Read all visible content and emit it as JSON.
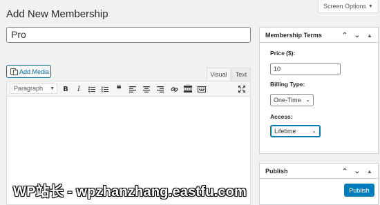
{
  "header": {
    "screen_options": "Screen Options",
    "page_title": "Add New Membership"
  },
  "title_field": {
    "value": "Pro"
  },
  "editor": {
    "add_media_label": "Add Media",
    "tabs": [
      "Visual",
      "Text"
    ],
    "active_tab": "Visual",
    "format_select": "Paragraph",
    "toolbar_icons": [
      "bold-icon",
      "italic-icon",
      "bulleted-list-icon",
      "numbered-list-icon",
      "blockquote-icon",
      "align-left-icon",
      "align-center-icon",
      "align-right-icon",
      "link-icon",
      "toolbar-toggle-icon",
      "fullscreen-icon"
    ]
  },
  "membership_terms": {
    "title": "Membership Terms",
    "price_label": "Price ($):",
    "price_value": "10",
    "billing_label": "Billing Type:",
    "billing_value": "One-Time",
    "access_label": "Access:",
    "access_value": "Lifetime"
  },
  "publish_box": {
    "title": "Publish",
    "button_label": "Publish"
  },
  "watermark": "WP站长 - wpzhanzhang.eastfu.com",
  "colors": {
    "accent": "#007cba",
    "link": "#0071a1",
    "background": "#f1f1f1"
  }
}
